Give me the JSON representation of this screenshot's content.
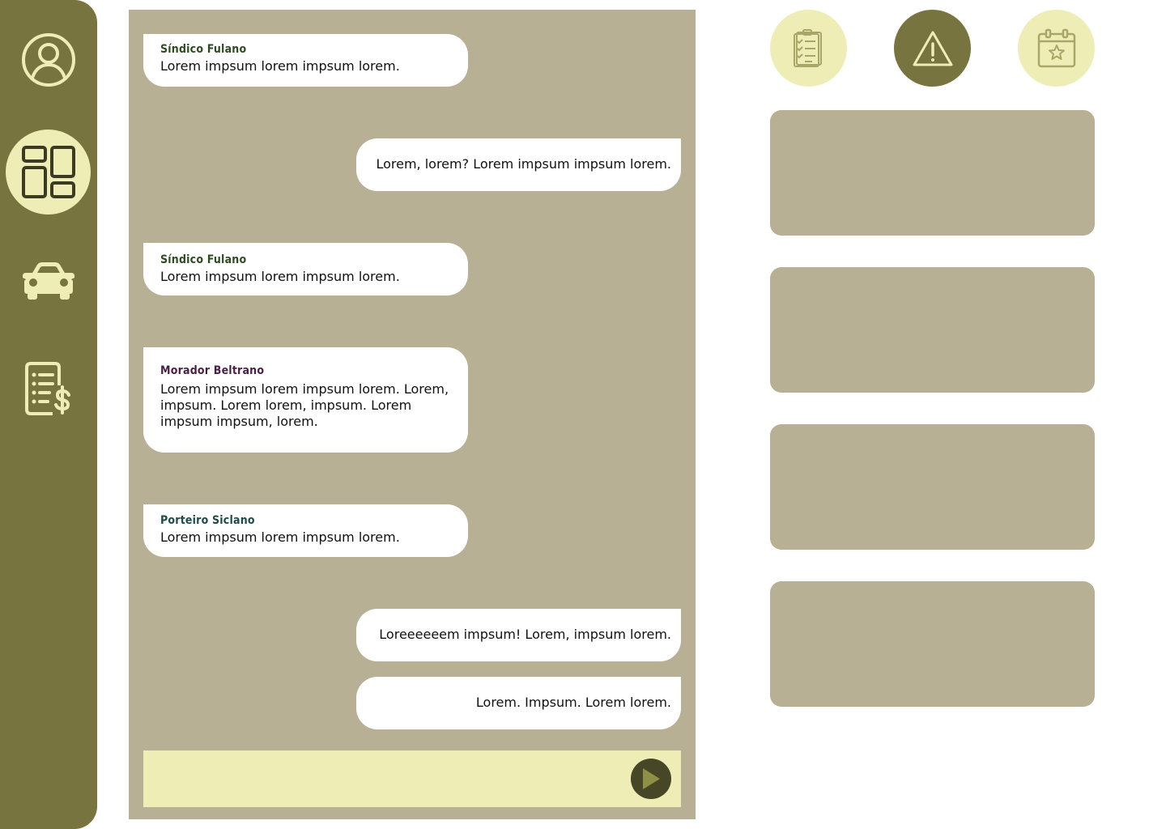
{
  "colors": {
    "sidebar": "#77743f",
    "sidebar_icon": "#efedb6",
    "chat_bg": "#b7b095",
    "composer_bg": "#efedb6",
    "send_button": "#464726",
    "send_arrow": "#8e9046",
    "sender_sindico": "#2e4d1f",
    "sender_morador": "#4a1f45",
    "sender_porteiro": "#1f4a4a"
  },
  "sidebar": {
    "items": [
      {
        "icon": "user-profile-icon",
        "active": false
      },
      {
        "icon": "dashboard-icon",
        "active": true
      },
      {
        "icon": "car-icon",
        "active": false
      },
      {
        "icon": "bill-icon",
        "active": false
      }
    ]
  },
  "chat": {
    "messages": [
      {
        "direction": "in",
        "sender": "Síndico Fulano",
        "text": "Lorem impsum lorem impsum lorem."
      },
      {
        "direction": "out",
        "text": "Lorem, lorem? Lorem impsum impsum lorem."
      },
      {
        "direction": "in",
        "sender": "Síndico Fulano",
        "text": "Lorem impsum lorem impsum lorem."
      },
      {
        "direction": "in",
        "sender": "Morador Beltrano",
        "text": "Lorem impsum lorem impsum lorem. Lorem, impsum. Lorem lorem, impsum. Lorem impsum impsum, lorem."
      },
      {
        "direction": "in",
        "sender": "Porteiro Siclano",
        "text": "Lorem impsum lorem impsum lorem."
      },
      {
        "direction": "out",
        "text": "Loreeeeeem impsum! Lorem, impsum lorem."
      },
      {
        "direction": "out",
        "text": "Lorem. Impsum. Lorem lorem."
      }
    ],
    "composer": {
      "value": ""
    }
  },
  "shortcuts": [
    {
      "icon": "checklist-icon",
      "active": false
    },
    {
      "icon": "warning-icon",
      "active": true
    },
    {
      "icon": "calendar-star-icon",
      "active": false
    }
  ],
  "cards": [
    {},
    {},
    {},
    {}
  ]
}
